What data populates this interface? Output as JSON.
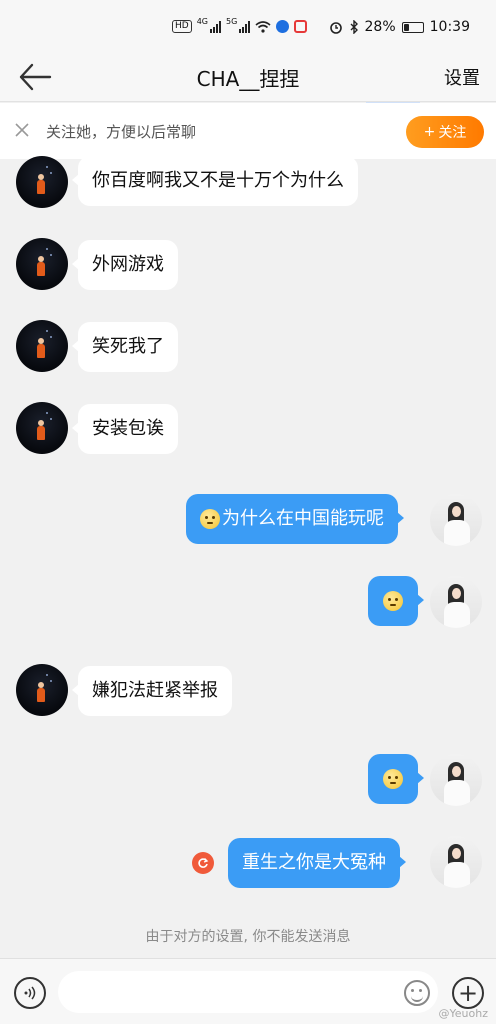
{
  "status_bar": {
    "hd_label": "HD",
    "net1": "4G",
    "net2": "5G",
    "battery_percent": "28%",
    "battery_level": 0.28,
    "time": "10:39"
  },
  "header": {
    "title": "CHA__捏捏",
    "settings_label": "设置"
  },
  "follow_banner": {
    "text": "关注她，方便以后常聊",
    "button_label": "关注"
  },
  "messages": [
    {
      "side": "left",
      "text": "你百度啊我又不是十万个为什么"
    },
    {
      "side": "left",
      "text": "外网游戏"
    },
    {
      "side": "left",
      "text": "笑死我了"
    },
    {
      "side": "left",
      "text": "安装包诶"
    },
    {
      "side": "right",
      "emoji": "thinking-emoji",
      "text": "为什么在中国能玩呢"
    },
    {
      "side": "right",
      "emoji": "thinking-emoji",
      "text": ""
    },
    {
      "side": "left",
      "text": "嫌犯法赶紧举报"
    },
    {
      "side": "right",
      "emoji": "thinking-emoji",
      "text": ""
    },
    {
      "side": "right",
      "text": "重生之你是大冤种",
      "status": "resend-icon"
    }
  ],
  "notice": "由于对方的设置, 你不能发送消息",
  "input_bar": {
    "placeholder": ""
  },
  "watermark": "@Yeuohz",
  "colors": {
    "outgoing_bubble": "#3b9cf5",
    "follow_button": "#ff8a00",
    "resend": "#f05a3a"
  }
}
